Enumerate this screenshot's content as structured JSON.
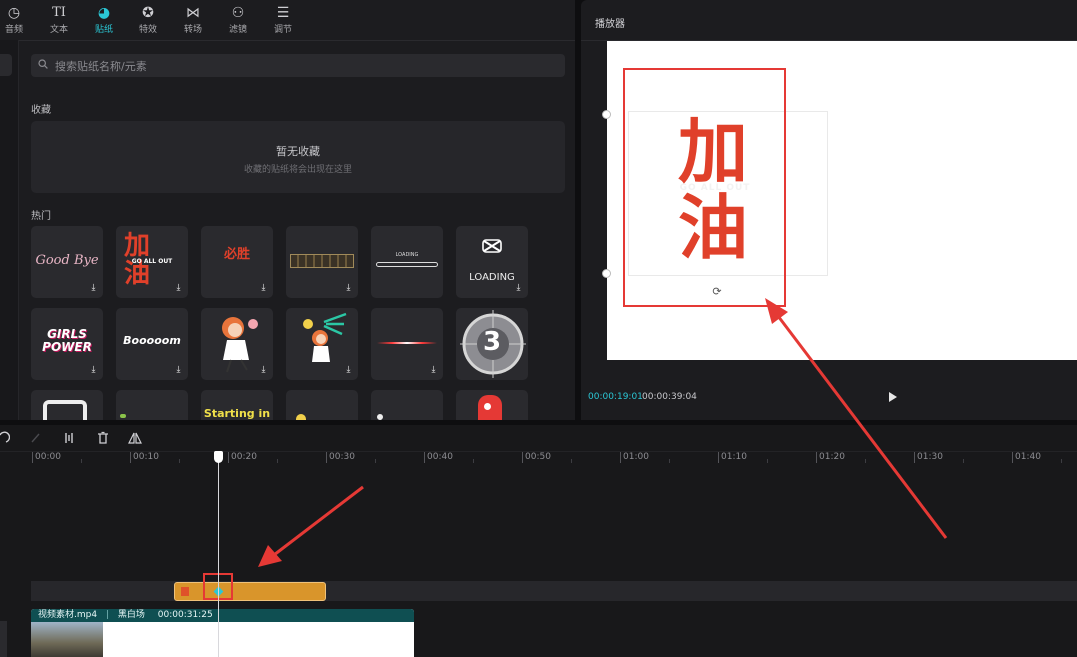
{
  "toolbar": {
    "items": [
      {
        "label": "音频",
        "icon": "audio-icon"
      },
      {
        "label": "文本",
        "icon": "text-icon"
      },
      {
        "label": "贴纸",
        "icon": "sticker-icon",
        "active": true
      },
      {
        "label": "特效",
        "icon": "effects-icon"
      },
      {
        "label": "转场",
        "icon": "transition-icon"
      },
      {
        "label": "滤镜",
        "icon": "filter-icon"
      },
      {
        "label": "调节",
        "icon": "adjust-icon"
      }
    ]
  },
  "search": {
    "placeholder": "搜索贴纸名称/元素"
  },
  "favorites": {
    "title": "收藏",
    "empty": "暂无收藏",
    "hint": "收藏的贴纸将会出现在这里"
  },
  "hot": {
    "title": "热门",
    "tiles": [
      {
        "text": "Good Bye"
      },
      {
        "text": "加油",
        "subtext": "GO ALL OUT"
      },
      {
        "text": "必胜"
      },
      {
        "text": ""
      },
      {
        "text": "LOADING"
      },
      {
        "text": "LOADING"
      },
      {
        "text": "GIRLS POWER"
      },
      {
        "text": "Booooom"
      },
      {
        "text": ""
      },
      {
        "text": ""
      },
      {
        "text": ""
      },
      {
        "text": "3"
      },
      {
        "text": ""
      },
      {
        "text": ""
      },
      {
        "text": "Starting in"
      },
      {
        "text": ""
      },
      {
        "text": ""
      },
      {
        "text": ""
      }
    ]
  },
  "player": {
    "title": "播放器",
    "sticker_text": "加油",
    "sticker_subtext": "GO ALL OUT",
    "time_current": "00:00:19:01",
    "time_total": "00:00:39:04"
  },
  "timeline": {
    "ticks": [
      "00:00",
      "00:10",
      "00:20",
      "00:30",
      "00:40",
      "00:50",
      "01:00",
      "01:10",
      "01:20",
      "01:30",
      "01:40"
    ],
    "video_clip": {
      "name": "视频素材.mp4",
      "effect": "黑白场",
      "duration": "00:00:31:25"
    }
  },
  "colors": {
    "accent": "#2bc7d5",
    "annotation": "#e53935",
    "sticker_clip": "#d9952b",
    "brand_red": "#e0402a"
  }
}
